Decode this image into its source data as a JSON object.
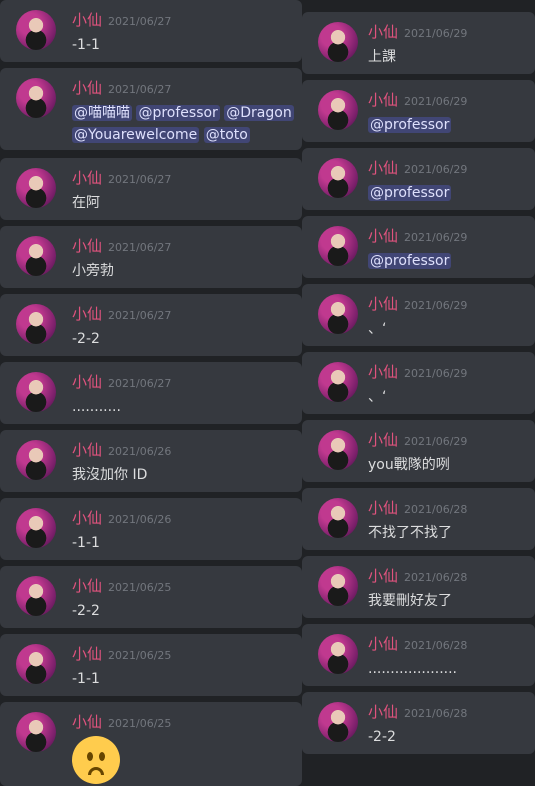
{
  "left_messages": [
    {
      "author": "小仙",
      "date": "2021/06/27",
      "text": "-1-1"
    },
    {
      "author": "小仙",
      "date": "2021/06/27",
      "mentions": [
        "@喵喵喵",
        "@professor",
        "@Dragon",
        "@Youarewelcome",
        "@toto"
      ]
    },
    {
      "author": "小仙",
      "date": "2021/06/27",
      "text": "在阿"
    },
    {
      "author": "小仙",
      "date": "2021/06/27",
      "text": "小旁勃"
    },
    {
      "author": "小仙",
      "date": "2021/06/27",
      "text": "-2-2"
    },
    {
      "author": "小仙",
      "date": "2021/06/27",
      "text": "..........."
    },
    {
      "author": "小仙",
      "date": "2021/06/26",
      "text": "我沒加你 ID"
    },
    {
      "author": "小仙",
      "date": "2021/06/26",
      "text": "-1-1"
    },
    {
      "author": "小仙",
      "date": "2021/06/25",
      "text": "-2-2"
    },
    {
      "author": "小仙",
      "date": "2021/06/25",
      "text": "-1-1"
    },
    {
      "author": "小仙",
      "date": "2021/06/25",
      "emoji": "frowning-face"
    }
  ],
  "right_messages": [
    {
      "author": "小仙",
      "date": "2021/06/29",
      "text": "上課"
    },
    {
      "author": "小仙",
      "date": "2021/06/29",
      "mention": "@professor"
    },
    {
      "author": "小仙",
      "date": "2021/06/29",
      "mention": "@professor"
    },
    {
      "author": "小仙",
      "date": "2021/06/29",
      "mention": "@professor"
    },
    {
      "author": "小仙",
      "date": "2021/06/29",
      "text": "、‘"
    },
    {
      "author": "小仙",
      "date": "2021/06/29",
      "text": "、‘"
    },
    {
      "author": "小仙",
      "date": "2021/06/29",
      "text": "you戰隊的咧"
    },
    {
      "author": "小仙",
      "date": "2021/06/28",
      "text": "不找了不找了"
    },
    {
      "author": "小仙",
      "date": "2021/06/28",
      "text": "我要刪好友了"
    },
    {
      "author": "小仙",
      "date": "2021/06/28",
      "text": "...................."
    },
    {
      "author": "小仙",
      "date": "2021/06/28",
      "text": "-2-2"
    }
  ]
}
